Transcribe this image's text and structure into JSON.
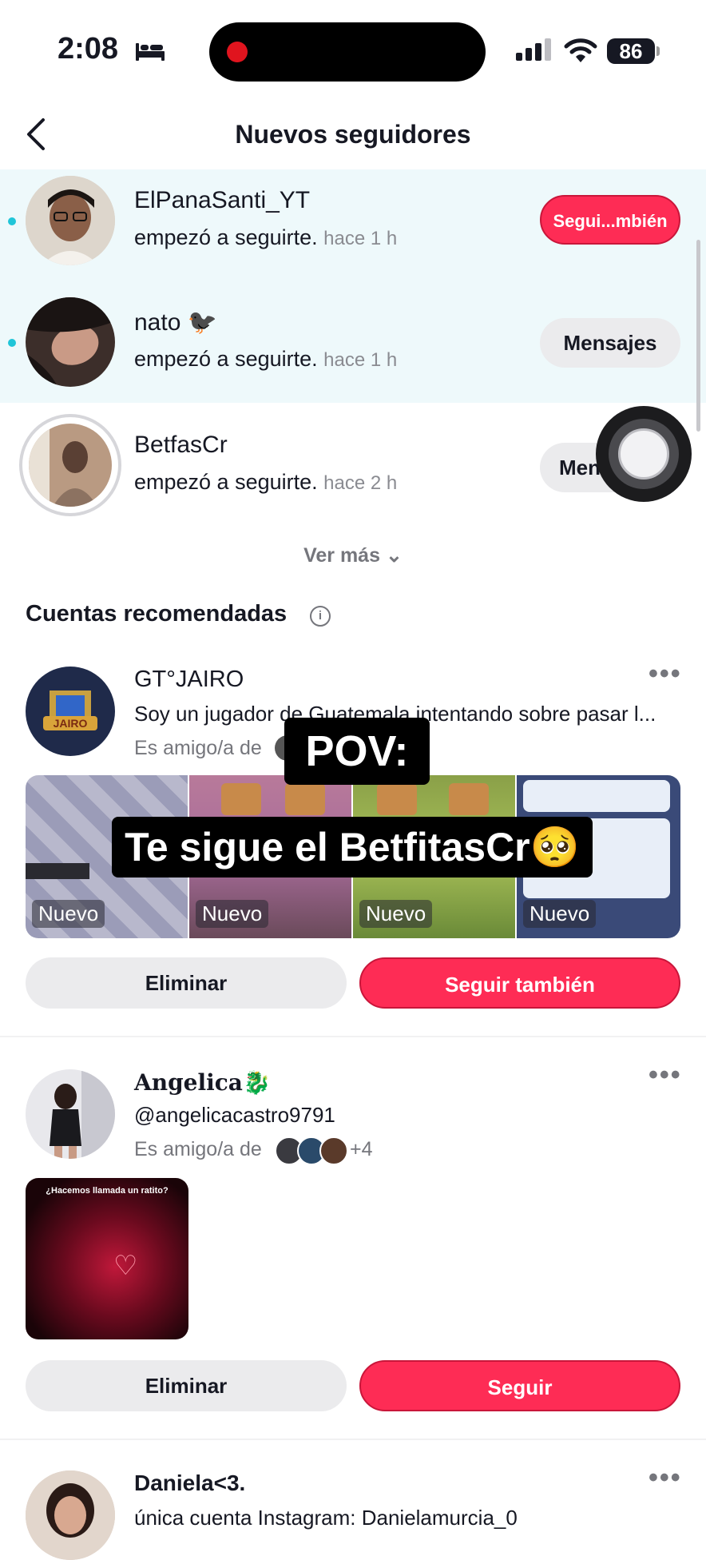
{
  "status": {
    "time": "2:08",
    "battery": "86"
  },
  "header": {
    "title": "Nuevos seguidores",
    "back_icon": "chevron-left-icon"
  },
  "new_followers": [
    {
      "name": "ElPanaSanti_YT",
      "action": "empezó a seguirte.",
      "time": "hace 1 h",
      "button": "Segui...mbién",
      "unread": true
    },
    {
      "name": "nato 🐦‍⬛",
      "action": "empezó a seguirte.",
      "time": "hace 1 h",
      "button": "Mensajes",
      "unread": true
    },
    {
      "name": "BetfasCr",
      "action": "empezó a seguirte.",
      "time": "hace 2 h",
      "button": "Mensajes",
      "unread": false
    }
  ],
  "see_more": "Ver más",
  "recommended": {
    "title": "Cuentas recomendadas",
    "accounts": [
      {
        "name": "GT°JAIRO",
        "bio": "Soy un jugador de Guatemala intentando sobre pasar l...",
        "mutual": "Es amigo/a de",
        "videos": [
          "Nuevo",
          "Nuevo",
          "Nuevo",
          "Nuevo"
        ],
        "remove": "Eliminar",
        "follow": "Seguir también"
      },
      {
        "name": "Angelica🐉",
        "handle": "@angelicacastro9791",
        "mutual": "Es amigo/a de",
        "mutual_extra": "+4",
        "video_caption": "¿Hacemos llamada un ratito?",
        "remove": "Eliminar",
        "follow": "Seguir"
      },
      {
        "name": "Daniela<3.",
        "bio": "única cuenta Instagram: Danielamurcia_0"
      }
    ]
  },
  "overlay": {
    "line1": "POV:",
    "line2": "Te sigue el BetfitasCr🥺"
  },
  "colors": {
    "accent": "#fe2c55",
    "highlight": "#eef9fb",
    "unread_dot": "#20c5d8"
  }
}
